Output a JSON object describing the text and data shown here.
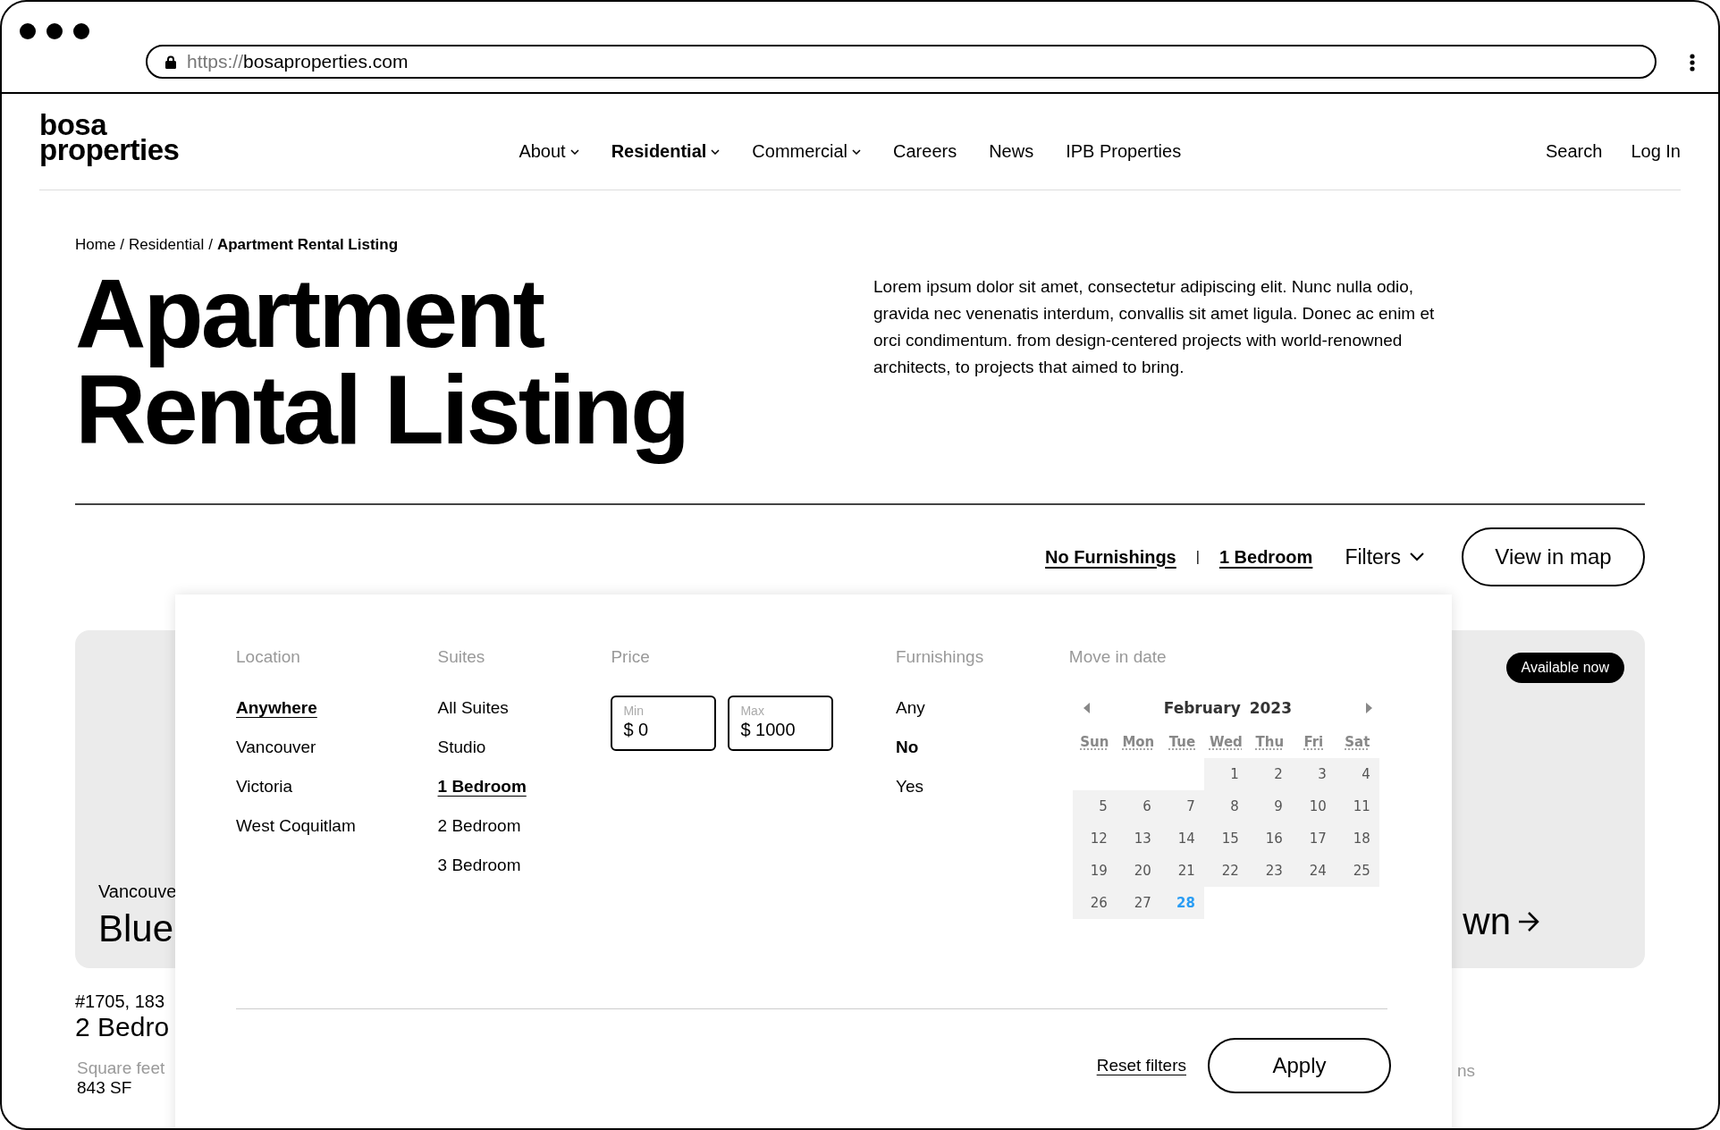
{
  "browser": {
    "url_scheme": "https://",
    "url_host": "bosaproperties.com"
  },
  "logo": [
    "bosa",
    "properties"
  ],
  "nav": [
    {
      "label": "About",
      "selected": false,
      "has_menu": true
    },
    {
      "label": "Residential",
      "selected": true,
      "has_menu": true
    },
    {
      "label": "Commercial",
      "selected": false,
      "has_menu": true
    },
    {
      "label": "Careers",
      "selected": false,
      "has_menu": false
    },
    {
      "label": "News",
      "selected": false,
      "has_menu": false
    },
    {
      "label": "IPB Properties",
      "selected": false,
      "has_menu": false
    }
  ],
  "header_actions": [
    "Search",
    "Log In"
  ],
  "breadcrumb": [
    {
      "kind": "link",
      "text": "Home"
    },
    {
      "kind": "separator",
      "text": "/"
    },
    {
      "kind": "link",
      "text": "Residential"
    },
    {
      "kind": "separator",
      "text": "/"
    },
    {
      "kind": "current",
      "text": "Apartment Rental Listing"
    }
  ],
  "title": "Apartment Rental Listing",
  "intro": "Lorem ipsum dolor sit amet, consectetur adipiscing elit. Nunc nulla odio, gravida nec venenatis interdum, convallis sit amet ligula. Donec ac enim et orci condimentum. from design-centered projects with world-renowned architects, to projects that aimed to bring.",
  "active_filters": [
    "No Furnishings",
    "1 Bedroom"
  ],
  "filter_separator": "|",
  "filters_button": "Filters",
  "map_button": "View in map",
  "listing": {
    "badge": "Available now",
    "city": "Vancouve",
    "name": "Blue",
    "name_end": "wn",
    "address": "#1705, 183",
    "unit": "2 Bedro",
    "area_label": "Square feet",
    "area": "843 SF",
    "label_end": "ns"
  },
  "filter_panel": {
    "columns": [
      {
        "kind": "link-options",
        "heading": "Location",
        "options": [
          {
            "label": "Anywhere",
            "selected": true
          },
          {
            "label": "Vancouver",
            "selected": false
          },
          {
            "label": "Victoria",
            "selected": false
          },
          {
            "label": "West Coquitlam",
            "selected": false
          }
        ]
      },
      {
        "kind": "link-options",
        "heading": "Suites",
        "options": [
          {
            "label": "All Suites",
            "selected": false
          },
          {
            "label": "Studio",
            "selected": false
          },
          {
            "label": "1 Bedroom",
            "selected": true
          },
          {
            "label": "2 Bedroom",
            "selected": false
          },
          {
            "label": "3 Bedroom",
            "selected": false
          }
        ]
      },
      {
        "kind": "price",
        "heading": "Price",
        "fields": [
          {
            "label": "Min",
            "value": "$ 0"
          },
          {
            "label": "Max",
            "value": "$ 1000"
          }
        ]
      },
      {
        "kind": "plain-options",
        "heading": "Furnishings",
        "options": [
          {
            "label": "Any",
            "selected": false
          },
          {
            "label": "No",
            "selected": true
          },
          {
            "label": "Yes",
            "selected": false
          }
        ]
      },
      {
        "kind": "calendar",
        "heading": "Move in date",
        "month": "February 2023",
        "weekdays": [
          "Sun",
          "Mon",
          "Tue",
          "Wed",
          "Thu",
          "Fri",
          "Sat"
        ],
        "weeks": [
          [
            {
              "kind": "blank"
            },
            {
              "kind": "blank"
            },
            {
              "kind": "blank"
            },
            {
              "kind": "day",
              "day": "1",
              "selected": false
            },
            {
              "kind": "day",
              "day": "2",
              "selected": false
            },
            {
              "kind": "day",
              "day": "3",
              "selected": false
            },
            {
              "kind": "day",
              "day": "4",
              "selected": false
            }
          ],
          [
            {
              "kind": "day",
              "day": "5",
              "selected": false
            },
            {
              "kind": "day",
              "day": "6",
              "selected": false
            },
            {
              "kind": "day",
              "day": "7",
              "selected": false
            },
            {
              "kind": "day",
              "day": "8",
              "selected": false
            },
            {
              "kind": "day",
              "day": "9",
              "selected": false
            },
            {
              "kind": "day",
              "day": "10",
              "selected": false
            },
            {
              "kind": "day",
              "day": "11",
              "selected": false
            }
          ],
          [
            {
              "kind": "day",
              "day": "12",
              "selected": false
            },
            {
              "kind": "day",
              "day": "13",
              "selected": false
            },
            {
              "kind": "day",
              "day": "14",
              "selected": false
            },
            {
              "kind": "day",
              "day": "15",
              "selected": false
            },
            {
              "kind": "day",
              "day": "16",
              "selected": false
            },
            {
              "kind": "day",
              "day": "17",
              "selected": false
            },
            {
              "kind": "day",
              "day": "18",
              "selected": false
            }
          ],
          [
            {
              "kind": "day",
              "day": "19",
              "selected": false
            },
            {
              "kind": "day",
              "day": "20",
              "selected": false
            },
            {
              "kind": "day",
              "day": "21",
              "selected": false
            },
            {
              "kind": "day",
              "day": "22",
              "selected": false
            },
            {
              "kind": "day",
              "day": "23",
              "selected": false
            },
            {
              "kind": "day",
              "day": "24",
              "selected": false
            },
            {
              "kind": "day",
              "day": "25",
              "selected": false
            }
          ],
          [
            {
              "kind": "day",
              "day": "26",
              "selected": false
            },
            {
              "kind": "day",
              "day": "27",
              "selected": false
            },
            {
              "kind": "day",
              "day": "28",
              "selected": true
            },
            {
              "kind": "blank"
            },
            {
              "kind": "blank"
            },
            {
              "kind": "blank"
            },
            {
              "kind": "blank"
            }
          ]
        ]
      }
    ],
    "reset": "Reset filters",
    "apply": "Apply"
  }
}
